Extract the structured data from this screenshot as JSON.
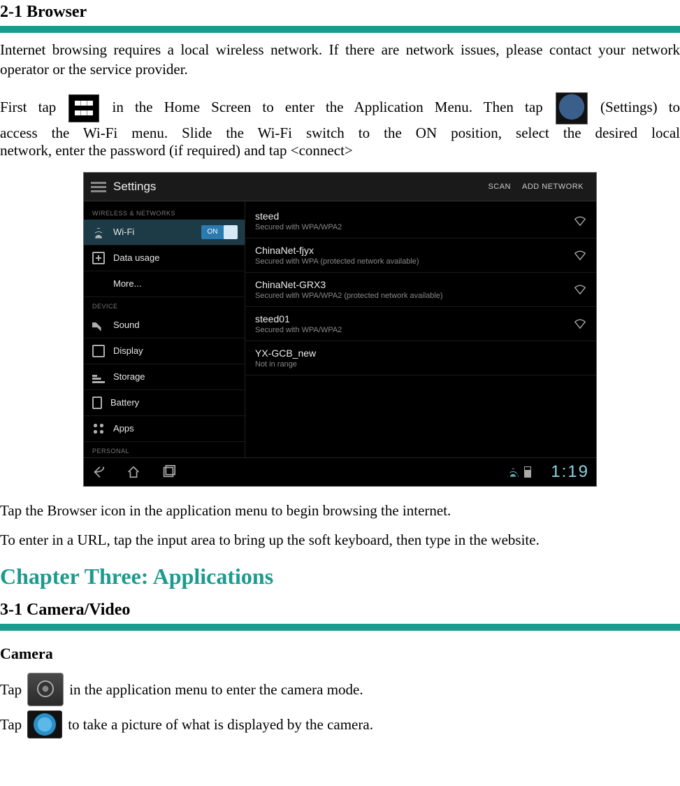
{
  "s21": {
    "heading": "2-1 Browser",
    "intro": "Internet browsing requires a local wireless network. If there are network issues, please contact your network operator or the service provider.",
    "p2a": "First tap",
    "p2b": "in the Home Screen to enter the Application Menu.   Then tap",
    "p2c": "(Settings) to",
    "p2d": "access  the  Wi-Fi  menu.    Slide  the  Wi-Fi  switch  to  the  ON  position,  select  the  desired  local",
    "p2e": "network, enter the password (if required) and tap <connect>",
    "p3": "Tap the Browser icon in the application menu to begin browsing the internet.",
    "p4": "To enter in a URL, tap the input area to bring up the soft keyboard, then type in the website."
  },
  "chapter3": "Chapter Three: Applications",
  "s31": {
    "heading": "3-1 Camera/Video",
    "sub": "Camera",
    "l1a": "Tap",
    "l1b": "in the application menu to enter the camera mode.",
    "l2a": "Tap",
    "l2b": "to take a picture of what is displayed by the camera."
  },
  "screenshot": {
    "title": "Settings",
    "scan": "SCAN",
    "addnet": "ADD NETWORK",
    "cat1": "WIRELESS & NETWORKS",
    "cat2": "DEVICE",
    "cat3": "PERSONAL",
    "left": {
      "wifi": "Wi-Fi",
      "on": "ON",
      "data": "Data usage",
      "more": "More...",
      "sound": "Sound",
      "display": "Display",
      "storage": "Storage",
      "battery": "Battery",
      "apps": "Apps"
    },
    "nets": [
      {
        "name": "steed",
        "sub": "Secured with WPA/WPA2"
      },
      {
        "name": "ChinaNet-fjyx",
        "sub": "Secured with WPA (protected network available)"
      },
      {
        "name": "ChinaNet-GRX3",
        "sub": "Secured with WPA/WPA2 (protected network available)"
      },
      {
        "name": "steed01",
        "sub": "Secured with WPA/WPA2"
      },
      {
        "name": "YX-GCB_new",
        "sub": "Not in range"
      }
    ],
    "clock": "1:19"
  }
}
